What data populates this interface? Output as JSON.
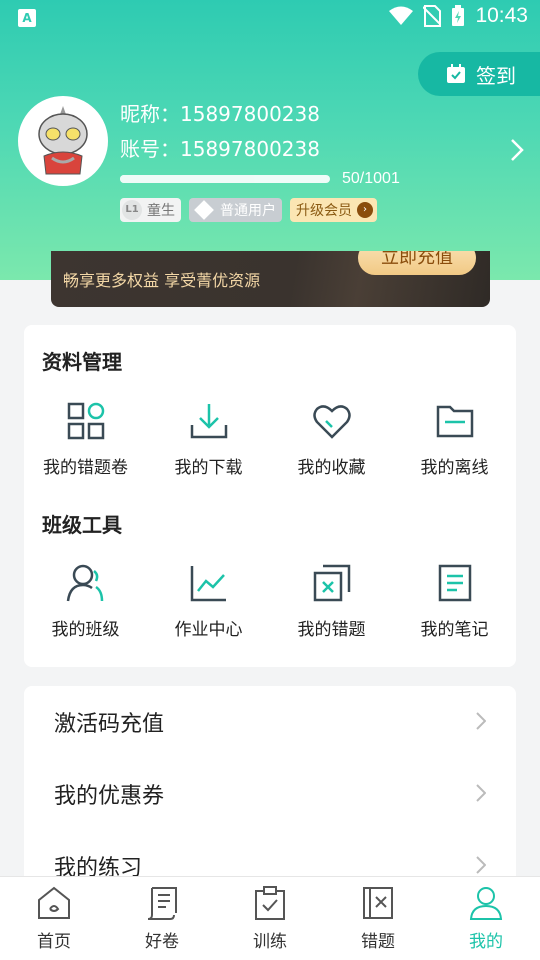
{
  "status_bar": {
    "app_badge": "A",
    "time": "10:43"
  },
  "header": {
    "checkin_label": "签到",
    "nickname_label": "昵称：",
    "nickname": "15897800238",
    "account_label": "账号：",
    "account": "15897800238",
    "progress_text": "50/1001",
    "progress_fraction": 0.05,
    "level_code": "L1",
    "level_name": "童生",
    "user_type": "普通用户",
    "upgrade_label": "升级会员"
  },
  "vip_banner": {
    "text": "畅享更多权益 享受菁优资源",
    "button": "立即充值"
  },
  "data_management": {
    "title": "资料管理",
    "items": [
      {
        "label": "我的错题卷",
        "icon": "grid-apps-icon"
      },
      {
        "label": "我的下载",
        "icon": "download-icon"
      },
      {
        "label": "我的收藏",
        "icon": "heart-icon"
      },
      {
        "label": "我的离线",
        "icon": "folder-icon"
      }
    ]
  },
  "class_tools": {
    "title": "班级工具",
    "items": [
      {
        "label": "我的班级",
        "icon": "class-user-icon"
      },
      {
        "label": "作业中心",
        "icon": "chart-line-icon"
      },
      {
        "label": "我的错题",
        "icon": "wrong-question-icon"
      },
      {
        "label": "我的笔记",
        "icon": "note-icon"
      }
    ]
  },
  "menu": {
    "items": [
      {
        "label": "激活码充值"
      },
      {
        "label": "我的优惠券"
      },
      {
        "label": "我的练习"
      }
    ]
  },
  "tabbar": {
    "items": [
      {
        "label": "首页",
        "icon": "home-icon"
      },
      {
        "label": "好卷",
        "icon": "scroll-icon"
      },
      {
        "label": "训练",
        "icon": "clipboard-check-icon"
      },
      {
        "label": "错题",
        "icon": "mistake-book-icon"
      },
      {
        "label": "我的",
        "icon": "person-icon",
        "active": true
      }
    ]
  },
  "colors": {
    "accent": "#1cc3a9",
    "header_top": "#2ecbb2",
    "header_bottom": "#7be8ad",
    "icon_dark": "#3a4a55"
  }
}
